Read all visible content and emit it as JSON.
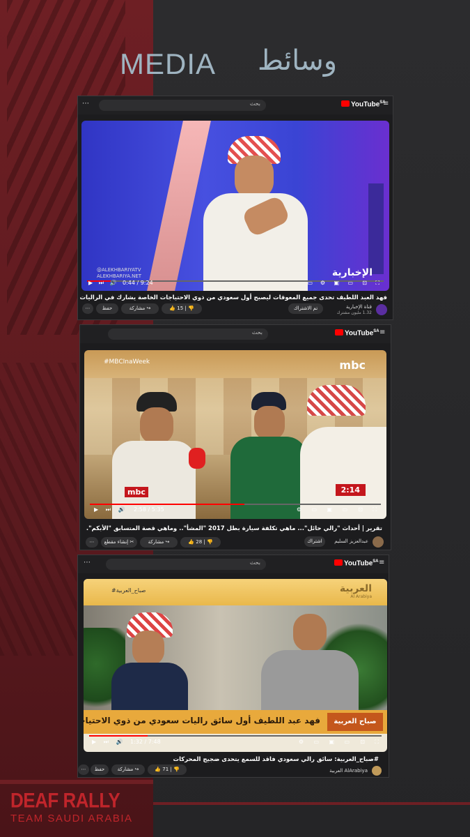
{
  "header": {
    "title_en": "MEDIA",
    "title_ar": "وسائط"
  },
  "videos": [
    {
      "search_placeholder": "بحث",
      "yt_label": "YouTube",
      "yt_region": "SA",
      "time": "0:44 / 9:24",
      "progress": 0.08,
      "watermark_1": "@ALEKHBARIYATV",
      "watermark_2": "ALEKHBARIYA.NET",
      "broadcaster": "الإخبارية",
      "title": "فهد العبد اللطيف تحدى جميع المعوقات ليصبح أول سعودي من ذوي الاحتياجات الخاصة يشارك في الراليات",
      "channel": "قناة الإخبارية",
      "subs": "1.32 مليون مشترك",
      "subscribe": "تم الاشتراك",
      "likes": "15",
      "share": "مشاركة",
      "save": "حفظ"
    },
    {
      "search_placeholder": "بحث",
      "yt_label": "YouTube",
      "yt_region": "SA",
      "time": "2:58 / 5:35",
      "progress": 0.53,
      "badge_time": "2:14",
      "hashtag": "#MBCInaWeek",
      "broadcaster": "mbc",
      "title": "تقرير | أحداث \"رالي حائل\"... ماهي تكلفة سيارة بطل 2017 \"المشأ\".. وماهي قصة المتسابق \"الأبكم\".",
      "channel": "عبدالعزيز السليم",
      "subscribe": "اشتراك",
      "likes": "28",
      "share": "مشاركة",
      "clip": "إنشاء مقطع"
    },
    {
      "search_placeholder": "بحث",
      "yt_label": "YouTube",
      "yt_region": "SA",
      "time": "1:32 / 7:48",
      "progress": 0.2,
      "hashtag": "#صباح_العربية",
      "broadcaster": "العربية",
      "broadcaster_sub": "Al Arabiya",
      "show": "صباح العربية",
      "lower_third": "فهد عبد اللطيف أول سائق راليات سعودي من ذوي الاحتياجات الخاصة",
      "title": "#صباح_العربية: سائق رالي سعودي فاقد للسمع يتحدى ضجيج المحركات",
      "channel": "AlArabiya العربية",
      "likes": "71",
      "share": "مشاركة",
      "save": "حفظ"
    }
  ],
  "footer": {
    "brand": "DEAF RALLY",
    "tagline": "TEAM SAUDI ARABIA"
  }
}
